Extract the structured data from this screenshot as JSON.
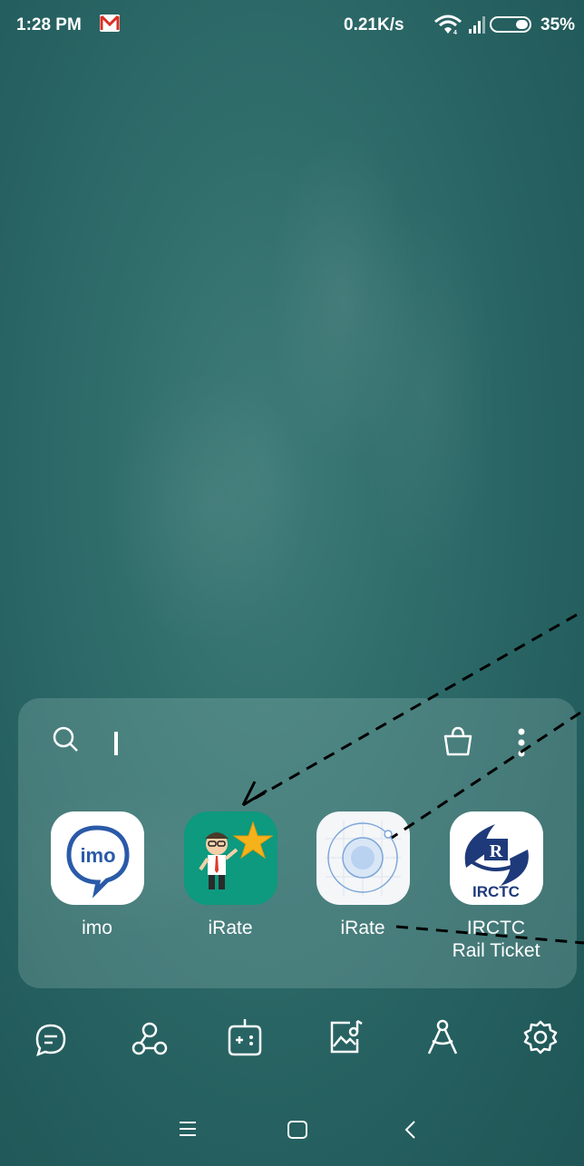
{
  "status_bar": {
    "time": "1:28 PM",
    "net_speed": "0.21K/s",
    "battery_pct": "35%",
    "battery_level": 0.35,
    "icons": [
      "gmail-icon",
      "wifi-icon",
      "signal-icon",
      "battery-icon"
    ]
  },
  "folder": {
    "search_placeholder": "",
    "typed_text": "I",
    "icons": [
      "search-icon",
      "shopping-bag-icon",
      "more-vert-icon"
    ],
    "apps": [
      {
        "label": "imo",
        "icon": "imo-icon"
      },
      {
        "label": "iRate",
        "icon": "irate-businessman-star-icon"
      },
      {
        "label": "iRate",
        "icon": "irate-circle-icon"
      },
      {
        "label": "IRCTC\nRail Ticket",
        "line1": "IRCTC",
        "line2": "Rail Ticket",
        "icon": "irctc-icon"
      }
    ],
    "colors": {
      "imo_blue": "#2a5aa8",
      "irate_green": "#0d9a7f",
      "irctc_navy": "#1e3a7a"
    }
  },
  "dock": {
    "icons": [
      "chat-icon",
      "share-nodes-icon",
      "gamepad-icon",
      "photo-edit-icon",
      "compass-icon",
      "gear-icon"
    ]
  },
  "nav_bar": {
    "icons": [
      "menu-icon",
      "home-square-icon",
      "back-chevron-icon"
    ]
  },
  "colors": {
    "wallpaper": "#2f6d6b",
    "folder_bg": "rgba(150,190,188,0.28)"
  }
}
